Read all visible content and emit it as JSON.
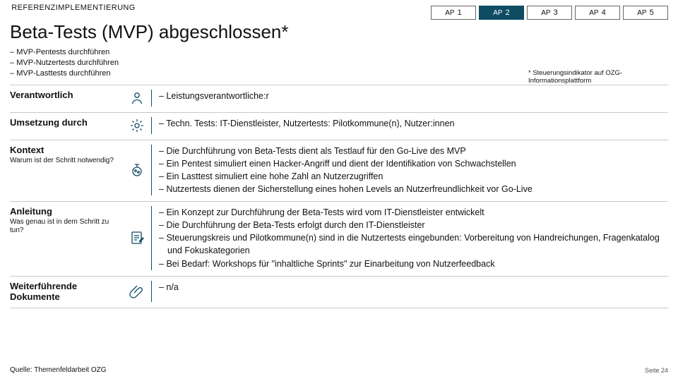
{
  "brand": "REFERENZIMPLEMENTIERUNG",
  "tabs": [
    {
      "prefix": "AP",
      "n": "1",
      "active": false
    },
    {
      "prefix": "AP",
      "n": "2",
      "active": true
    },
    {
      "prefix": "AP",
      "n": "3",
      "active": false
    },
    {
      "prefix": "AP",
      "n": "4",
      "active": false
    },
    {
      "prefix": "AP",
      "n": "5",
      "active": false
    }
  ],
  "title": "Beta-Tests (MVP) abgeschlossen*",
  "intro_bullets": [
    "MVP-Pentests durchführen",
    "MVP-Nutzertests durchführen",
    "MVP-Lasttests durchführen"
  ],
  "footnote": "* Steuerungsindikator auf OZG-Informationsplattform",
  "rows": {
    "responsibility": {
      "label": "Verantwortlich",
      "items": [
        "Leistungsverantwortliche:r"
      ]
    },
    "execution": {
      "label": "Umsetzung durch",
      "items": [
        "Techn. Tests: IT-Dienstleister, Nutzertests: Pilotkommune(n), Nutzer:innen"
      ]
    },
    "context": {
      "label": "Kontext",
      "sub": "Warum ist der Schritt notwendig?",
      "items": [
        "Die Durchführung von Beta-Tests dient als Testlauf für den Go-Live des MVP",
        "Ein Pentest simuliert einen Hacker-Angriff und dient der Identifikation von Schwachstellen",
        "Ein Lasttest simuliert eine hohe Zahl an Nutzerzugriffen",
        "Nutzertests dienen der Sicherstellung eines hohen Levels an Nutzerfreundlichkeit vor Go-Live"
      ]
    },
    "guide": {
      "label": "Anleitung",
      "sub": "Was genau ist in dem Schritt zu tun?",
      "items": [
        "Ein Konzept zur Durchführung der Beta-Tests wird vom IT-Dienstleister entwickelt",
        "Die Durchführung der Beta-Tests erfolgt durch den IT-Dienstleister",
        "Steuerungskreis und Pilotkommune(n) sind in die Nutzertests eingebunden: Vorbereitung von Handreichungen, Fragenkatalog und Fokuskategorien",
        "Bei Bedarf: Workshops für \"inhaltliche Sprints\" zur Einarbeitung von Nutzerfeedback"
      ]
    },
    "docs": {
      "label": "Weiterführende Dokumente",
      "items": [
        "n/a"
      ]
    }
  },
  "source": "Quelle: Themenfeldarbeit OZG",
  "page_label": "Seite 24"
}
